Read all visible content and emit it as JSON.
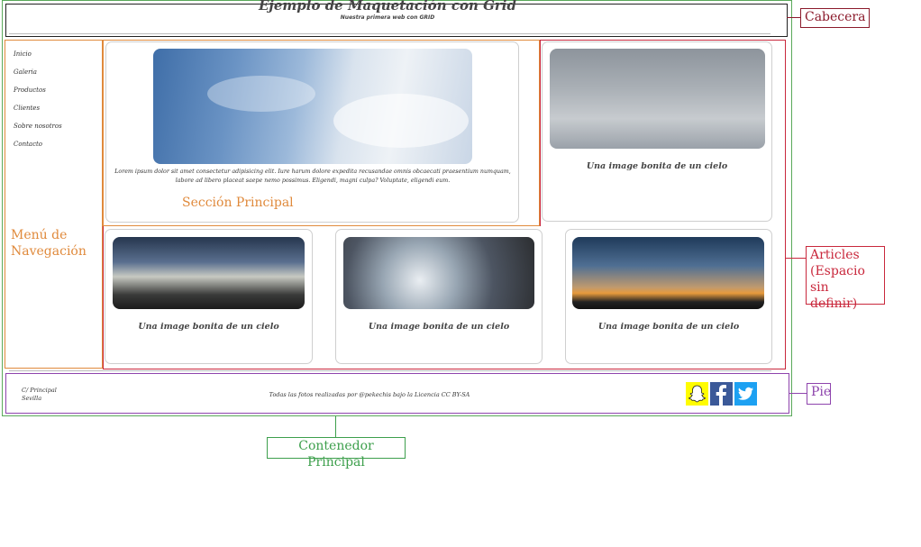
{
  "header": {
    "title": "Ejemplo de Maquetación con Grid",
    "subtitle": "Nuestra primera web con GRID"
  },
  "nav": {
    "items": [
      "Inicio",
      "Galeria",
      "Productos",
      "Clientes",
      "Sobre nosotros",
      "Contacto"
    ],
    "annotation_line1": "Menú de",
    "annotation_line2": "Navegación"
  },
  "main_section": {
    "text": "Lorem ipsum dolor sit amet consectetur adipisicing elit. Iure harum dolore expedita recusandae omnis obcaecati praesentium numquam, labore ad libero placeat saepe nemo possimus. Eligendi, magni culpa? Voluptate, eligendi eum.",
    "annotation": "Sección Principal"
  },
  "articles": [
    {
      "caption": "Una image bonita de un cielo"
    },
    {
      "caption": "Una image bonita de un cielo"
    },
    {
      "caption": "Una image bonita de un cielo"
    },
    {
      "caption": "Una image bonita de un cielo"
    }
  ],
  "footer": {
    "address_line1": "C/ Principal",
    "address_line2": "Sevilla",
    "credits": "Todas las fotos realizadas por @pekechis bajo la Licencia CC BY-SA",
    "social_icons": [
      "snapchat-icon",
      "facebook-icon",
      "twitter-icon"
    ]
  },
  "annotations": {
    "cabecera": "Cabecera",
    "articles_line1": "Articles",
    "articles_line2": "(Espacio sin",
    "articles_line3": "definir)",
    "pie": "Pie",
    "contenedor": "Contenedor Principal"
  },
  "colors": {
    "header_border": "#222222",
    "nav_section": "#e08a3c",
    "articles": "#c9283c",
    "footer": "#8e44ad",
    "container": "#3d9f4c"
  }
}
